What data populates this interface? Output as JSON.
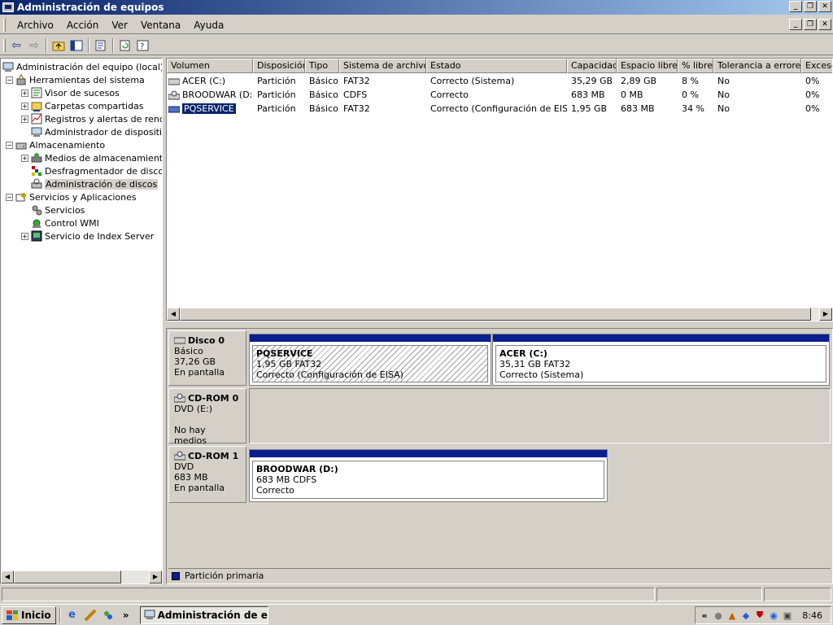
{
  "window": {
    "title": "Administración de equipos",
    "minimize": "_",
    "restore": "❐",
    "close": "✕"
  },
  "menu": [
    "Archivo",
    "Acción",
    "Ver",
    "Ventana",
    "Ayuda"
  ],
  "toolbar_icons": [
    "back-icon",
    "forward-icon",
    "up-folder-icon",
    "show-hide-tree-icon",
    "properties-icon",
    "refresh-icon",
    "help-icon"
  ],
  "tree": {
    "root": "Administración del equipo (local)",
    "items": [
      {
        "label": "Herramientas del sistema",
        "icon": "tools-icon"
      },
      {
        "label": "Visor de sucesos",
        "icon": "event-viewer-icon"
      },
      {
        "label": "Carpetas compartidas",
        "icon": "shared-folders-icon"
      },
      {
        "label": "Registros y alertas de rendim",
        "icon": "performance-logs-icon"
      },
      {
        "label": "Administrador de dispositivos",
        "icon": "device-manager-icon"
      },
      {
        "label": "Almacenamiento",
        "icon": "storage-icon"
      },
      {
        "label": "Medios de almacenamiento e",
        "icon": "removable-storage-icon"
      },
      {
        "label": "Desfragmentador de disco",
        "icon": "defragmenter-icon"
      },
      {
        "label": "Administración de discos",
        "icon": "disk-management-icon"
      },
      {
        "label": "Servicios y Aplicaciones",
        "icon": "services-apps-icon"
      },
      {
        "label": "Servicios",
        "icon": "services-icon"
      },
      {
        "label": "Control WMI",
        "icon": "wmi-control-icon"
      },
      {
        "label": "Servicio de Index Server",
        "icon": "index-server-icon"
      }
    ],
    "selected": "Administración de discos"
  },
  "volumes": {
    "columns": [
      "Volumen",
      "Disposición",
      "Tipo",
      "Sistema de archivos",
      "Estado",
      "Capacidad",
      "Espacio libre",
      "% libre",
      "Tolerancia a errores",
      "Exceso"
    ],
    "rows": [
      [
        "ACER (C:)",
        "Partición",
        "Básico",
        "FAT32",
        "Correcto (Sistema)",
        "35,29 GB",
        "2,89 GB",
        "8 %",
        "No",
        "0%"
      ],
      [
        "BROODWAR (D:)",
        "Partición",
        "Básico",
        "CDFS",
        "Correcto",
        "683 MB",
        "0 MB",
        "0 %",
        "No",
        "0%"
      ],
      [
        "PQSERVICE",
        "Partición",
        "Básico",
        "FAT32",
        "Correcto (Configuración de EISA)",
        "1,95 GB",
        "683 MB",
        "34 %",
        "No",
        "0%"
      ]
    ],
    "selected_row": "PQSERVICE"
  },
  "disks": [
    {
      "name": "Disco 0",
      "line1": "Básico",
      "line2": "37,26 GB",
      "line3": "En pantalla",
      "partitions": [
        {
          "name": "PQSERVICE",
          "size": "1,95 GB FAT32",
          "status": "Correcto (Configuración de EISA)"
        },
        {
          "name": "ACER  (C:)",
          "size": "35,31 GB FAT32",
          "status": "Correcto (Sistema)"
        }
      ]
    },
    {
      "name": "CD-ROM 0",
      "line1": "DVD (E:)",
      "line2": "",
      "line3": "No hay medios",
      "partitions": []
    },
    {
      "name": "CD-ROM 1",
      "line1": "DVD",
      "line2": "683 MB",
      "line3": "En pantalla",
      "partitions": [
        {
          "name": "BROODWAR  (D:)",
          "size": "683 MB CDFS",
          "status": "Correcto"
        }
      ]
    }
  ],
  "legend": {
    "label": "Partición primaria",
    "color": "#0a1f8f"
  },
  "taskbar": {
    "start": "Inicio",
    "task": "Administración de eq...",
    "chevron": "»",
    "tray_chevron": "«",
    "clock": "8:46"
  },
  "colors": {
    "titlebar": "#0a246a",
    "face": "#d4d0c8",
    "selection": "#0a246a"
  }
}
